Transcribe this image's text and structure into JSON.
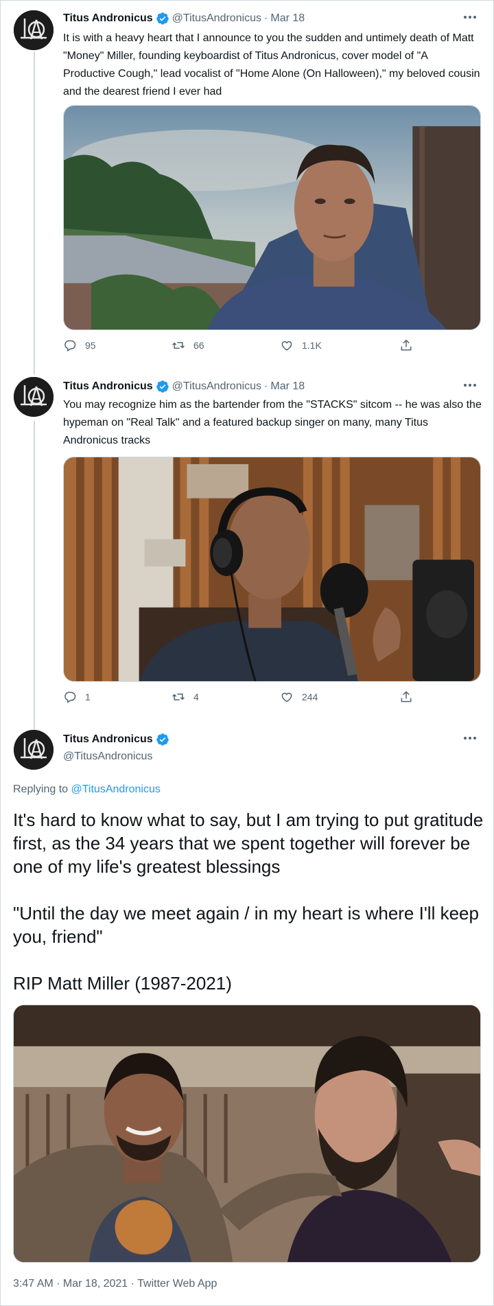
{
  "account": {
    "name": "Titus Andronicus",
    "handle": "@TitusAndronicus"
  },
  "tweet1": {
    "date": "Mar 18",
    "text": "It is with a heavy heart that I announce to you the sudden and untimely death of Matt \"Money\" Miller, founding keyboardist of Titus Andronicus, cover model of \"A Productive Cough,\" lead vocalist of \"Home Alone (On Halloween),\" my beloved cousin and the dearest friend I ever had",
    "replies": "95",
    "retweets": "66",
    "likes": "1.1K"
  },
  "tweet2": {
    "date": "Mar 18",
    "text": "You may recognize him as the bartender from the \"STACKS\" sitcom -- he was also the hypeman on \"Real Talk\" and a featured backup singer on many, many Titus Andronicus tracks",
    "replies": "1",
    "retweets": "4",
    "likes": "244"
  },
  "tweet3": {
    "replying_label": "Replying to",
    "replying_handle": "@TitusAndronicus",
    "para1": "It's hard to know what to say, but I am trying to put gratitude first, as the 34 years that we spent together will forever be one of my life's greatest blessings",
    "para2": "\"Until the day we meet again / in my heart is where I'll keep you, friend\"",
    "para3": "RIP Matt Miller (1987-2021)",
    "timestamp": "3:47 AM · Mar 18, 2021 · Twitter Web App"
  },
  "colors": {
    "accent": "#1d9bf0",
    "muted": "#536471",
    "border": "#cfd9de"
  },
  "icons": [
    "avatar-logo",
    "verified-badge-icon",
    "more-icon",
    "reply-icon",
    "retweet-icon",
    "like-icon",
    "share-icon"
  ]
}
